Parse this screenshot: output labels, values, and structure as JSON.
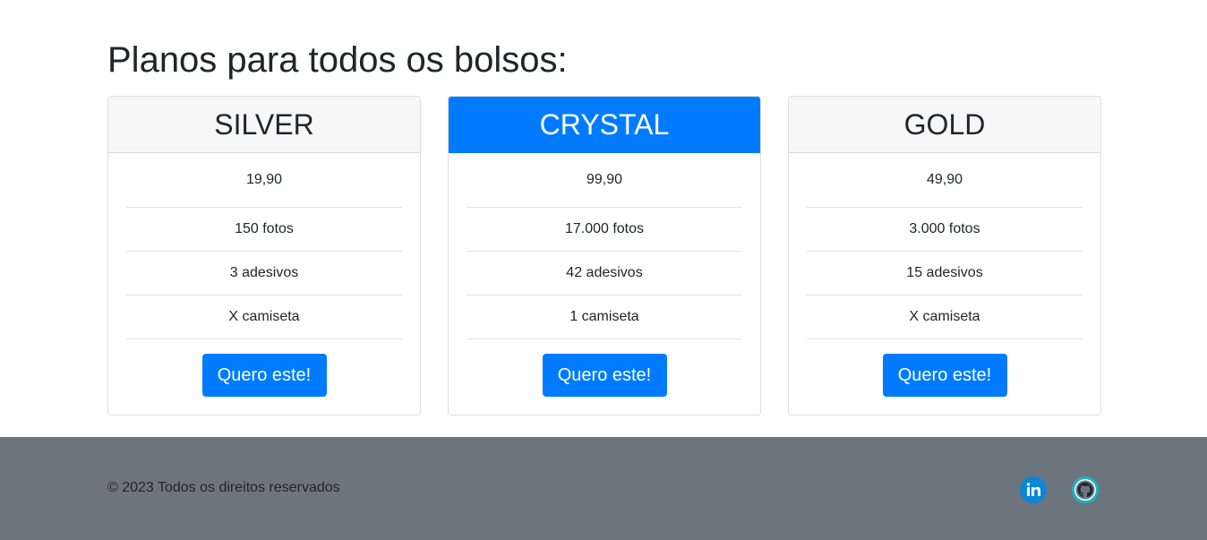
{
  "heading": "Planos para todos os bolsos:",
  "plans": [
    {
      "name": "SILVER",
      "price": "19,90",
      "features": [
        "150 fotos",
        "3 adesivos",
        "X camiseta"
      ],
      "button_label": "Quero este!"
    },
    {
      "name": "CRYSTAL",
      "price": "99,90",
      "features": [
        "17.000 fotos",
        "42 adesivos",
        "1 camiseta"
      ],
      "button_label": "Quero este!"
    },
    {
      "name": "GOLD",
      "price": "49,90",
      "features": [
        "3.000 fotos",
        "15 adesivos",
        "X camiseta"
      ],
      "button_label": "Quero este!"
    }
  ],
  "footer": {
    "copyright": "© 2023 Todos os direitos reservados",
    "social": [
      {
        "icon": "linkedin-icon",
        "color": "#0a87d6"
      },
      {
        "icon": "github-icon",
        "color": "#1ab3c7"
      }
    ]
  },
  "colors": {
    "accent": "#007bff",
    "footer_bg": "#6c757d",
    "header_bg": "#f7f7f7"
  }
}
